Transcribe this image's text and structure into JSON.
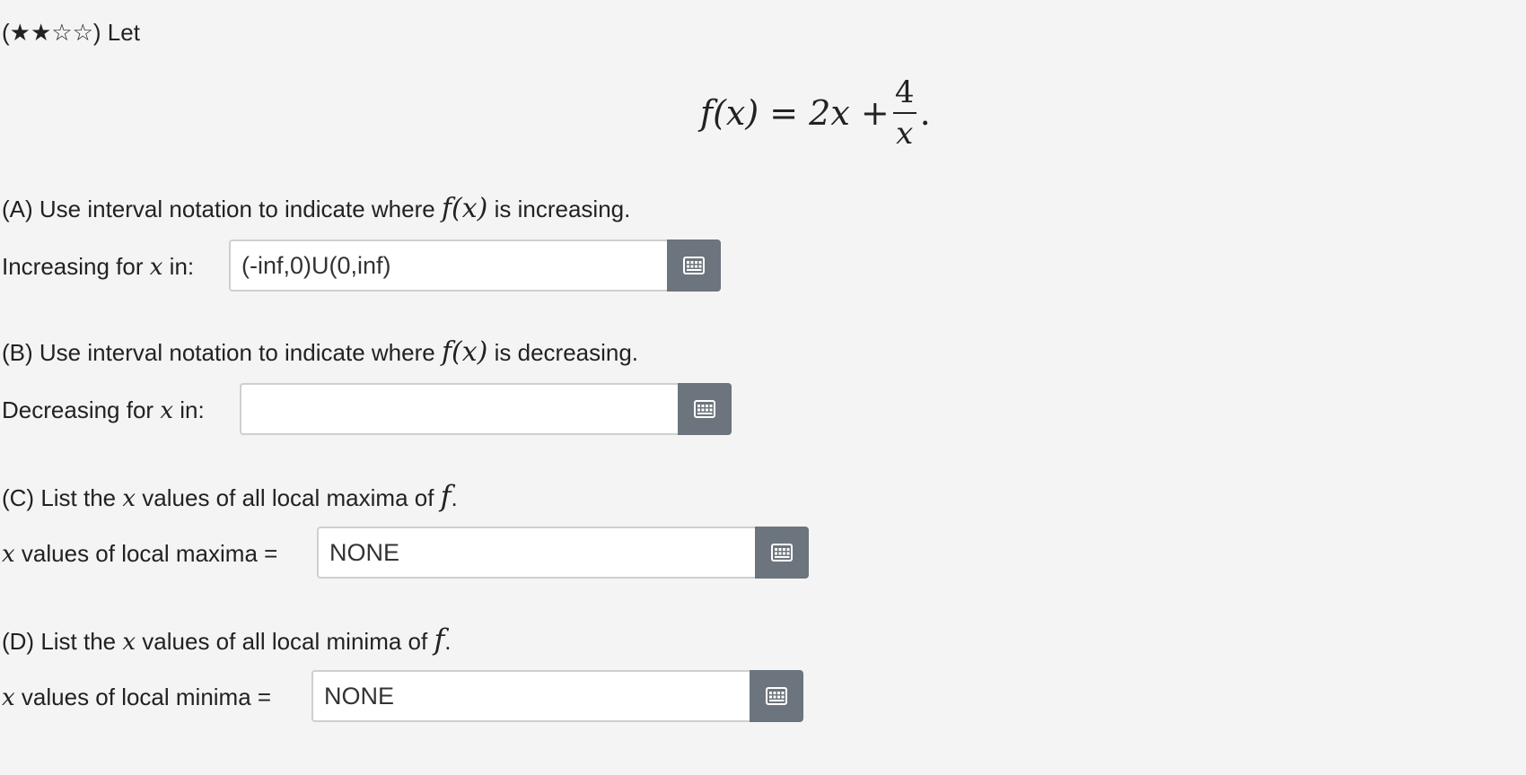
{
  "rating": {
    "stars": "(★★☆☆)",
    "label": "Let"
  },
  "equation": {
    "lhs": "f(x) = 2x +",
    "numerator": "4",
    "denominator": "x",
    "end": "."
  },
  "parts": {
    "a": {
      "prompt_pre": "(A) Use interval notation to indicate where",
      "func": "f(x)",
      "prompt_post": "is increasing.",
      "label_pre": "Increasing for",
      "var": "x",
      "label_post": "in:",
      "value": "(-inf,0)U(0,inf)"
    },
    "b": {
      "prompt_pre": "(B) Use interval notation to indicate where",
      "func": "f(x)",
      "prompt_post": "is decreasing.",
      "label_pre": "Decreasing for",
      "var": "x",
      "label_post": "in:",
      "value": ""
    },
    "c": {
      "prompt_pre": "(C) List the",
      "var": "x",
      "prompt_post": "values of all local maxima of",
      "func": "f",
      "end": ".",
      "label": "values of local maxima =",
      "value": "NONE"
    },
    "d": {
      "prompt_pre": "(D) List the",
      "var": "x",
      "prompt_post": "values of all local minima of",
      "func": "f",
      "end": ".",
      "label": "values of local minima =",
      "value": "NONE"
    }
  },
  "icons": {
    "keyboard": "math-keyboard-icon"
  },
  "colors": {
    "background": "#f4f4f4",
    "button": "#6c757d"
  }
}
